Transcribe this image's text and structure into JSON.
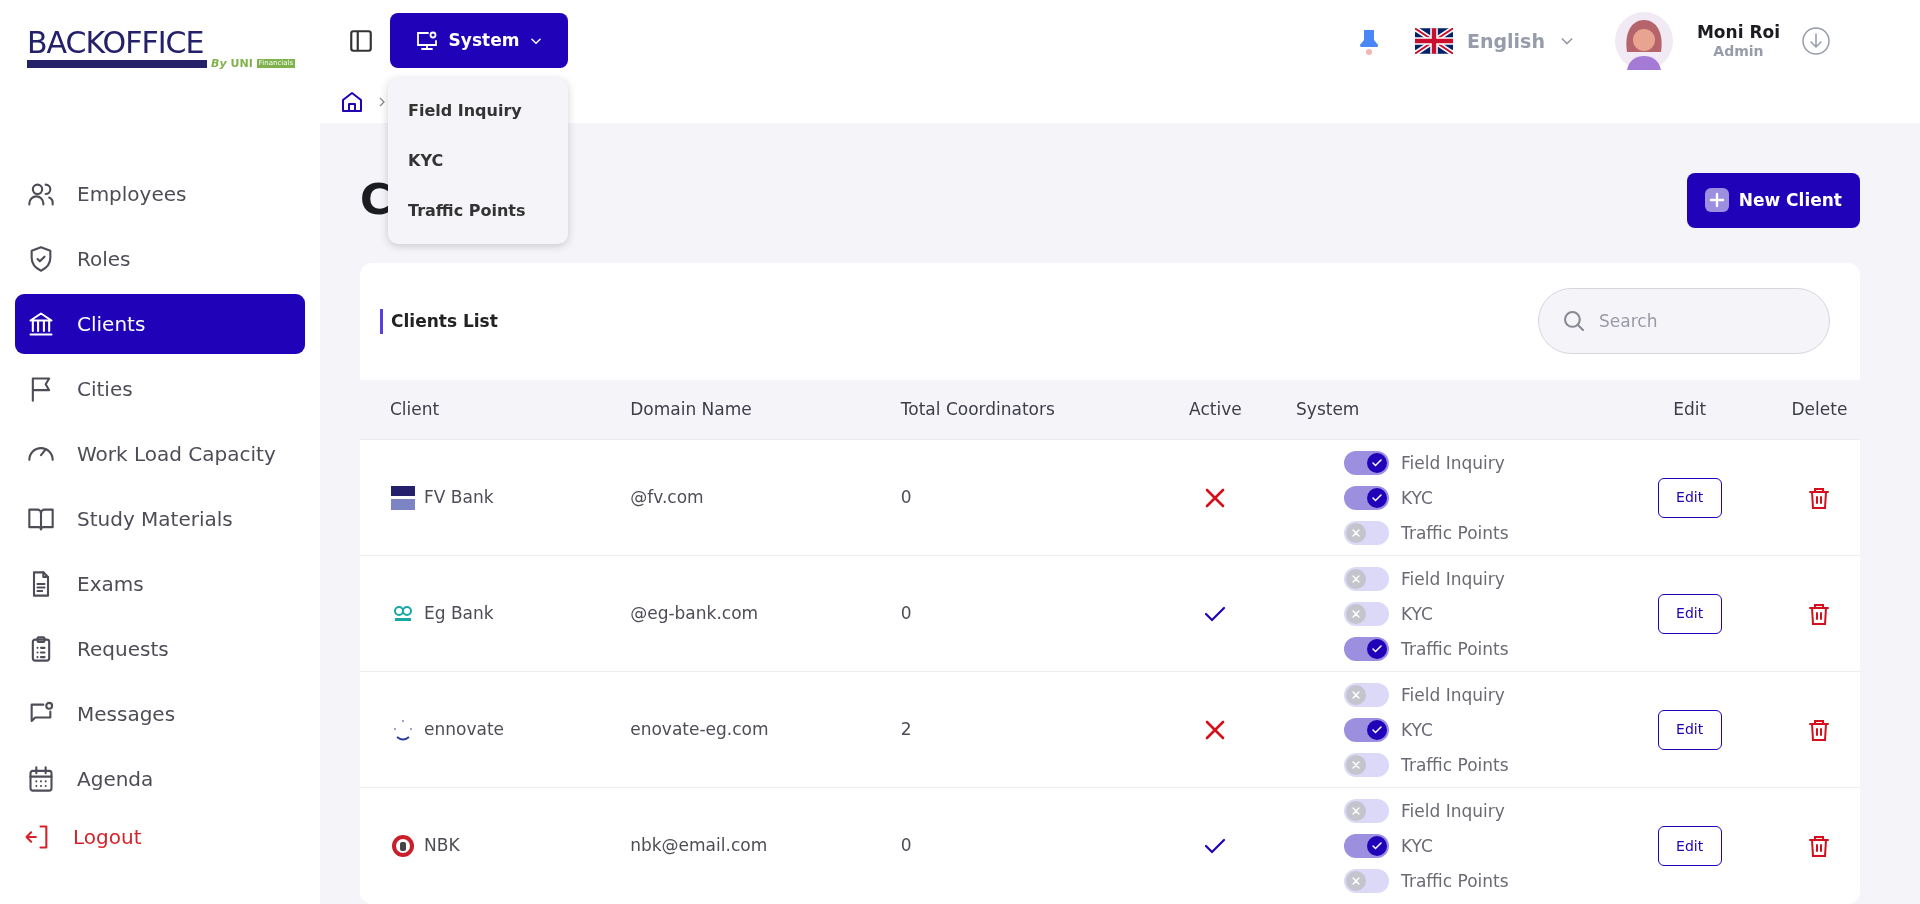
{
  "logo": {
    "title": "BACKOFFICE",
    "by": "By",
    "brand": "UNI",
    "brand_suffix": "Financials"
  },
  "header": {
    "system_button": "System",
    "system_menu": [
      "Field Inquiry",
      "KYC",
      "Traffic Points"
    ],
    "language": "English",
    "user": {
      "name": "Moni Roi",
      "role": "Admin"
    }
  },
  "sidebar": {
    "items": [
      {
        "label": "Employees",
        "kind": "nav",
        "selected": false
      },
      {
        "label": "Roles",
        "kind": "nav",
        "selected": false
      },
      {
        "label": "Clients",
        "kind": "nav",
        "selected": true
      },
      {
        "label": "Cities",
        "kind": "nav",
        "selected": false
      },
      {
        "label": "Work Load Capacity",
        "kind": "nav",
        "selected": false
      },
      {
        "label": "Study Materials",
        "kind": "nav",
        "selected": false
      },
      {
        "label": "Exams",
        "kind": "nav",
        "selected": false
      },
      {
        "label": "Requests",
        "kind": "nav",
        "selected": false
      },
      {
        "label": "Messages",
        "kind": "nav",
        "selected": false
      },
      {
        "label": "Agenda",
        "kind": "nav",
        "selected": false
      },
      {
        "label": "Logout",
        "kind": "logout",
        "selected": false
      }
    ]
  },
  "page_title": "C",
  "new_client_button": "New Client",
  "clients_card": {
    "title": "Clients List",
    "search": {
      "placeholder": "Search"
    },
    "columns": [
      "Client",
      "Domain Name",
      "Total Coordinators",
      "Active",
      "System",
      "Edit",
      "Delete"
    ],
    "rows": [
      {
        "client": "FV Bank",
        "domain": "@fv.com",
        "total_coordinators": "0",
        "active": false,
        "systems": [
          {
            "label": "Field Inquiry",
            "on": true
          },
          {
            "label": "KYC",
            "on": true
          },
          {
            "label": "Traffic Points",
            "on": false
          }
        ],
        "edit": "Edit"
      },
      {
        "client": "Eg Bank",
        "domain": "@eg-bank.com",
        "total_coordinators": "0",
        "active": true,
        "systems": [
          {
            "label": "Field Inquiry",
            "on": false
          },
          {
            "label": "KYC",
            "on": false
          },
          {
            "label": "Traffic Points",
            "on": true
          }
        ],
        "edit": "Edit"
      },
      {
        "client": "ennovate",
        "domain": "enovate-eg.com",
        "total_coordinators": "2",
        "active": false,
        "systems": [
          {
            "label": "Field Inquiry",
            "on": false
          },
          {
            "label": "KYC",
            "on": true
          },
          {
            "label": "Traffic Points",
            "on": false
          }
        ],
        "edit": "Edit"
      },
      {
        "client": "NBK",
        "domain": "nbk@email.com",
        "total_coordinators": "0",
        "active": true,
        "systems": [
          {
            "label": "Field Inquiry",
            "on": false
          },
          {
            "label": "KYC",
            "on": true
          },
          {
            "label": "Traffic Points",
            "on": false
          }
        ],
        "edit": "Edit"
      }
    ]
  }
}
